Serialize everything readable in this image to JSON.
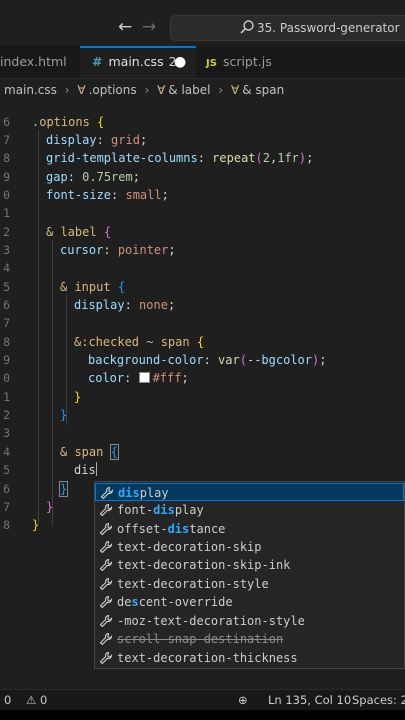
{
  "titlebar": {
    "back_icon": "arrow-left-icon",
    "forward_icon": "arrow-right-icon",
    "search_text": "35. Password-generator"
  },
  "tabs": [
    {
      "label": "index.html",
      "icon": "html-file-icon",
      "active": false
    },
    {
      "label": "main.css",
      "icon": "css-file-icon",
      "problems": "2",
      "active": true,
      "dirty": true
    },
    {
      "label": "script.js",
      "icon": "js-file-icon",
      "icon_text": "JS",
      "active": false
    }
  ],
  "breadcrumb": {
    "file": "main.css",
    "parts": [
      ".options",
      "& label",
      "& span"
    ]
  },
  "editor": {
    "lines": [
      {
        "n": "6",
        "text": ".options {"
      },
      {
        "n": "7",
        "text": "display: grid;"
      },
      {
        "n": "8",
        "text": "grid-template-columns: repeat(2,1fr);"
      },
      {
        "n": "9",
        "text": "gap: 0.75rem;"
      },
      {
        "n": "0",
        "text": "font-size: small;"
      },
      {
        "n": "1",
        "text": ""
      },
      {
        "n": "2",
        "text": "& label {"
      },
      {
        "n": "3",
        "text": "cursor: pointer;"
      },
      {
        "n": "4",
        "text": ""
      },
      {
        "n": "5",
        "text": "& input {"
      },
      {
        "n": "6",
        "text": "display: none;"
      },
      {
        "n": "7",
        "text": ""
      },
      {
        "n": "8",
        "text": "&:checked ~ span {"
      },
      {
        "n": "9",
        "text": "background-color: var(--bgcolor);"
      },
      {
        "n": "0",
        "text": "color: #fff;"
      },
      {
        "n": "1",
        "text": "}"
      },
      {
        "n": "2",
        "text": "}"
      },
      {
        "n": "3",
        "text": ""
      },
      {
        "n": "4",
        "text": "& span {"
      },
      {
        "n": "5",
        "text": "dis"
      },
      {
        "n": "6",
        "text": "}"
      },
      {
        "n": "7",
        "text": "}"
      },
      {
        "n": "8",
        "text": "}"
      }
    ],
    "typed": "dis"
  },
  "suggestions": [
    {
      "label": "display",
      "match": "dis",
      "selected": true
    },
    {
      "label": "font-display",
      "match": "dis"
    },
    {
      "label": "offset-distance",
      "match": "dis"
    },
    {
      "label": "text-decoration-skip",
      "match": "dis"
    },
    {
      "label": "text-decoration-skip-ink",
      "match": "dis"
    },
    {
      "label": "text-decoration-style",
      "match": "dis"
    },
    {
      "label": "descent-override",
      "match": "dis"
    },
    {
      "label": "-moz-text-decoration-style",
      "match": "dis"
    },
    {
      "label": "scroll-snap-destination",
      "match": "dis",
      "deprecated": true
    },
    {
      "label": "text-decoration-thickness",
      "match": "dis"
    }
  ],
  "statusbar": {
    "errors": "0",
    "warnings": "0",
    "position": "Ln 135, Col 10",
    "spaces": "Spaces: 2"
  },
  "colors": {
    "accent": "#0078d4",
    "editor_bg": "#1f1f1f",
    "selector": "#d7ba7d",
    "property": "#9cdcfe"
  }
}
